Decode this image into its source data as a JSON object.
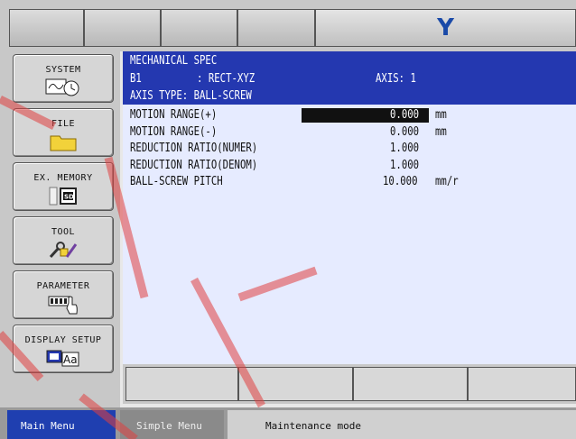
{
  "top_bar": {
    "logo_text": "Y"
  },
  "sidebar": {
    "items": [
      {
        "label": "SYSTEM",
        "icon": "system-icon"
      },
      {
        "label": "FILE",
        "icon": "folder-icon"
      },
      {
        "label": "EX. MEMORY",
        "icon": "sd-card-icon"
      },
      {
        "label": "TOOL",
        "icon": "tool-icon"
      },
      {
        "label": "PARAMETER",
        "icon": "parameter-icon"
      },
      {
        "label": "DISPLAY SETUP",
        "icon": "display-setup-icon"
      }
    ]
  },
  "header": {
    "title": "MECHANICAL SPEC",
    "robot_id": "B1",
    "robot_type": ": RECT-XYZ",
    "axis_label": "AXIS: 1",
    "axis_type": "AXIS TYPE: BALL-SCREW"
  },
  "params": [
    {
      "name": "MOTION RANGE(+)",
      "value": "0.000",
      "unit": "mm"
    },
    {
      "name": "MOTION RANGE(-)",
      "value": "0.000",
      "unit": "mm"
    },
    {
      "name": "REDUCTION RATIO(NUMER)",
      "value": "1.000",
      "unit": ""
    },
    {
      "name": "REDUCTION RATIO(DENOM)",
      "value": "1.000",
      "unit": ""
    },
    {
      "name": "BALL-SCREW PITCH",
      "value": "10.000",
      "unit": "mm/r"
    }
  ],
  "bottom_bar": {
    "main_menu": "Main Menu",
    "simple_menu": "Simple Menu",
    "status": "Maintenance mode"
  },
  "colors": {
    "header_bg": "#2438b0",
    "content_bg": "#e6ebff",
    "logo": "#1a4aa8"
  }
}
